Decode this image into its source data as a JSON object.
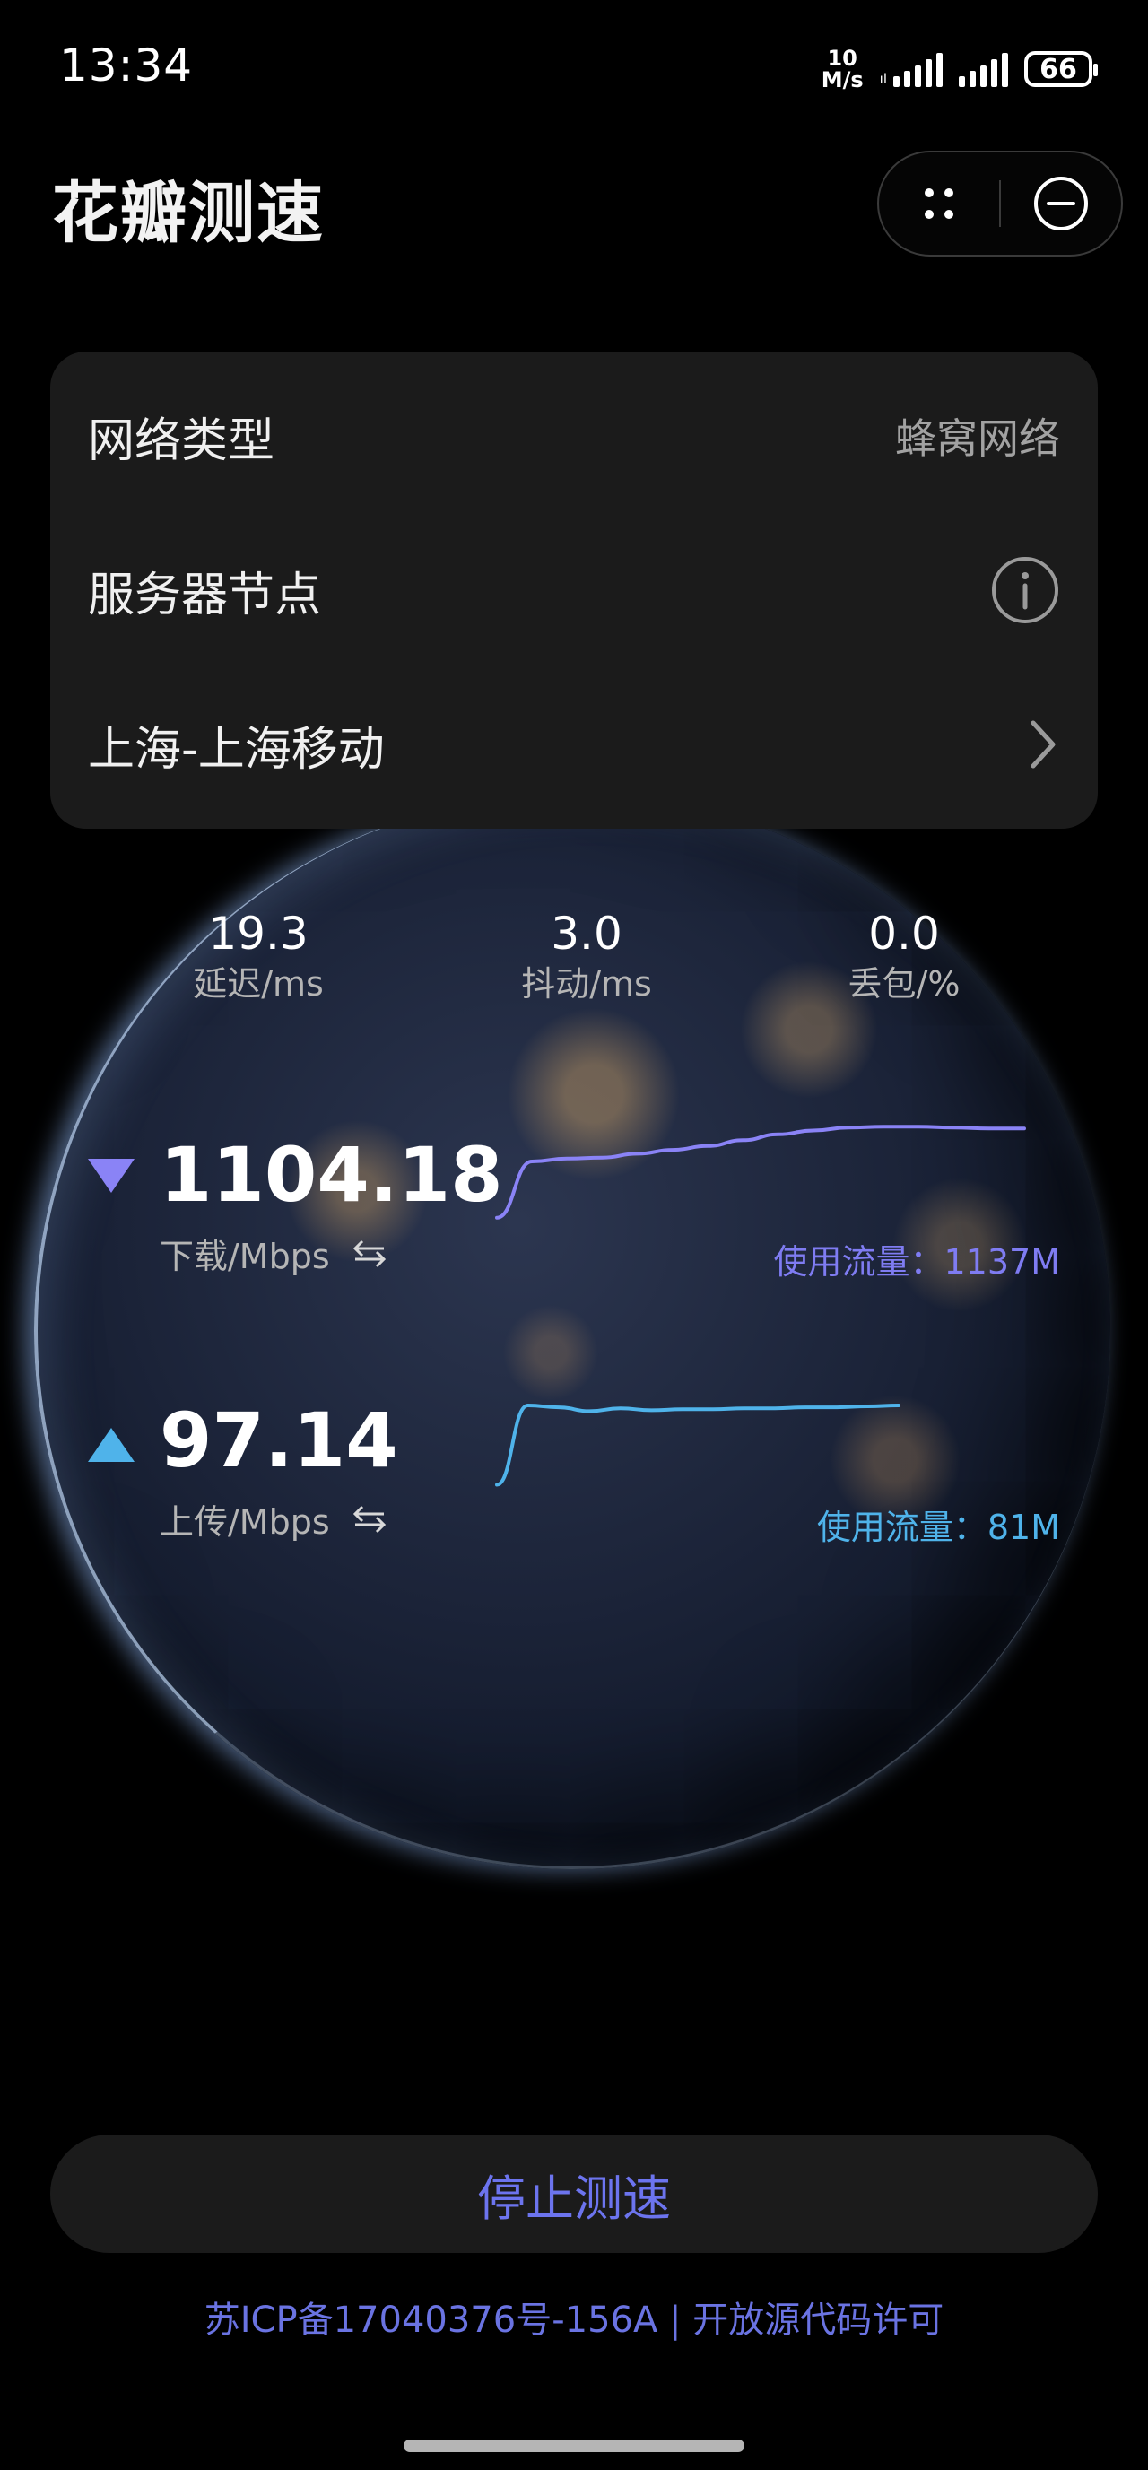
{
  "status_bar": {
    "time": "13:34",
    "net_speed_value": "10",
    "net_speed_unit": "M/s",
    "battery": "66"
  },
  "header": {
    "title": "花瓣测速"
  },
  "info": {
    "network_type_label": "网络类型",
    "network_type_value": "蜂窝网络",
    "server_node_label": "服务器节点",
    "server_value": "上海-上海移动"
  },
  "metrics": {
    "latency_value": "19.3",
    "latency_label": "延迟/ms",
    "jitter_value": "3.0",
    "jitter_label": "抖动/ms",
    "loss_value": "0.0",
    "loss_label": "丢包/%"
  },
  "download": {
    "value": "1104.18",
    "label": "下载/Mbps",
    "traffic": "使用流量：1137M",
    "color": "#8a83f6"
  },
  "upload": {
    "value": "97.14",
    "label": "上传/Mbps",
    "traffic": "使用流量：81M",
    "color": "#4fb3ea"
  },
  "chart_data": [
    {
      "type": "line",
      "name_bound": false,
      "series": [
        {
          "values": [
            4,
            62,
            65,
            66,
            70,
            74,
            78,
            84,
            90,
            94,
            97,
            98,
            98,
            97,
            96,
            96
          ]
        }
      ]
    },
    {
      "type": "line",
      "name_bound": false,
      "series": [
        {
          "values": [
            6,
            88,
            86,
            82,
            85,
            83,
            84,
            84,
            85,
            85,
            86,
            86,
            87,
            88
          ]
        }
      ]
    }
  ],
  "actions": {
    "stop_label": "停止测速"
  },
  "footer": {
    "license": "苏ICP备17040376号-156A | 开放源代码许可"
  }
}
